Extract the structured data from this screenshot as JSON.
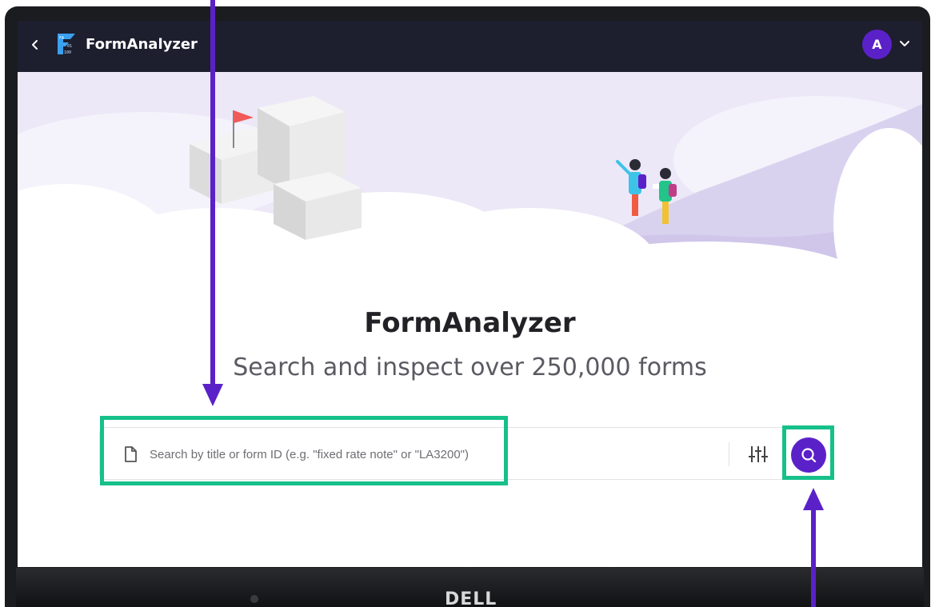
{
  "app": {
    "name": "FormAnalyzer",
    "logo_text": [
      "FA",
      "01",
      "100"
    ]
  },
  "user": {
    "avatar_initial": "A"
  },
  "hero": {
    "title": "FormAnalyzer",
    "subtitle": "Search and inspect over 250,000 forms"
  },
  "search": {
    "placeholder": "Search by title or form ID (e.g. \"fixed rate note\" or \"LA3200\")",
    "value": ""
  },
  "device": {
    "brand": "DELL"
  },
  "icons": {
    "back": "chevron-left-icon",
    "account_menu": "chevron-down-icon",
    "document": "document-icon",
    "filter": "sliders-icon",
    "search": "search-icon"
  },
  "colors": {
    "topbar": "#1d1e2e",
    "accent": "#5b21c9",
    "highlight": "#16c08a",
    "hero_sky": "#ece8f7"
  }
}
